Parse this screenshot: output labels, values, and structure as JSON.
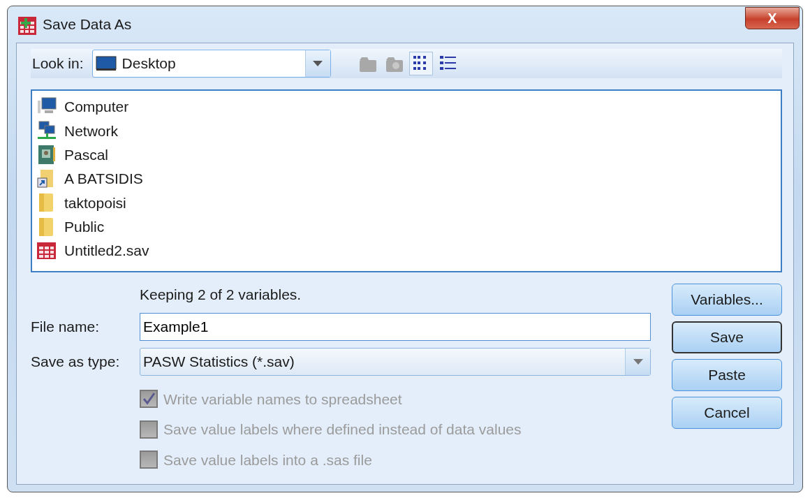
{
  "window": {
    "title": "Save Data As",
    "close": "X"
  },
  "look_in": {
    "label": "Look in:",
    "value": "Desktop"
  },
  "toolbar": [
    {
      "kind": "up",
      "disabled": true
    },
    {
      "kind": "newfolder",
      "disabled": true
    },
    {
      "kind": "list",
      "selected": true
    },
    {
      "kind": "details",
      "selected": false
    }
  ],
  "files": [
    {
      "name": "Computer",
      "kind": "computer"
    },
    {
      "name": "Network",
      "kind": "network"
    },
    {
      "name": "Pascal",
      "kind": "user"
    },
    {
      "name": "A BATSIDIS",
      "kind": "shortcut"
    },
    {
      "name": "taktopoisi",
      "kind": "folder"
    },
    {
      "name": "Public",
      "kind": "folder"
    },
    {
      "name": "Untitled2.sav",
      "kind": "sav"
    }
  ],
  "keeping": "Keeping 2 of 2 variables.",
  "file_name": {
    "label": "File name:",
    "value": "Example1"
  },
  "save_as_type": {
    "label": "Save as type:",
    "value": "PASW Statistics (*.sav)"
  },
  "options": [
    {
      "label": "Write variable names to spreadsheet",
      "checked": true,
      "disabled": true
    },
    {
      "label": "Save value labels where defined instead of data values",
      "checked": false,
      "disabled": true
    },
    {
      "label": "Save value labels into a .sas file",
      "checked": false,
      "disabled": true
    }
  ],
  "buttons": [
    {
      "label": "Variables...",
      "default": false
    },
    {
      "label": "Save",
      "default": true
    },
    {
      "label": "Paste",
      "default": false
    },
    {
      "label": "Cancel",
      "default": false
    }
  ]
}
